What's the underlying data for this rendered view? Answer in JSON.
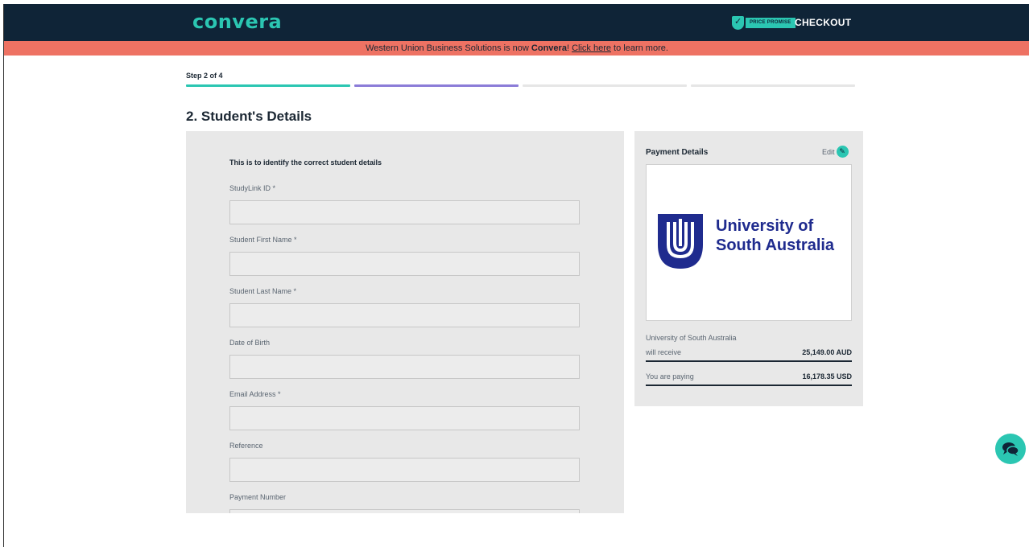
{
  "header": {
    "logo": "convera",
    "price_promise_badge": "PRICE PROMISE",
    "checkout_label": "CHECKOUT"
  },
  "banner": {
    "text_before": "Western Union Business Solutions is now ",
    "brand": "Convera",
    "text_mid": "! ",
    "link": "Click here",
    "text_after": " to learn more."
  },
  "progress": {
    "step_label": "Step 2 of 4",
    "current_step": 2,
    "total_steps": 4
  },
  "form": {
    "section_title": "2. Student's Details",
    "intro": "This is to identify the correct student details",
    "fields": [
      {
        "label": "StudyLink ID *",
        "value": ""
      },
      {
        "label": "Student First Name *",
        "value": ""
      },
      {
        "label": "Student Last Name *",
        "value": ""
      },
      {
        "label": "Date of Birth",
        "value": ""
      },
      {
        "label": "Email Address *",
        "value": ""
      },
      {
        "label": "Reference",
        "value": ""
      },
      {
        "label": "Payment Number",
        "value": ""
      }
    ]
  },
  "payment": {
    "title": "Payment Details",
    "edit_label": "Edit",
    "institution_logo_line1": "University of",
    "institution_logo_line2": "South Australia",
    "institution": "University of South Australia",
    "will_receive_label": "will receive",
    "will_receive_amount": "25,149.00 AUD",
    "paying_label": "You are paying",
    "paying_amount": "16,178.35 USD"
  },
  "icons": {
    "edit": "pencil-icon",
    "chat": "chat-bubbles-icon",
    "promise": "shield-check-icon"
  },
  "colors": {
    "header_bg": "#0f2437",
    "accent_teal": "#2bc6b2",
    "banner_bg": "#ee7263",
    "step_purple": "#8b7cd8",
    "university_blue": "#1f2b8e"
  }
}
